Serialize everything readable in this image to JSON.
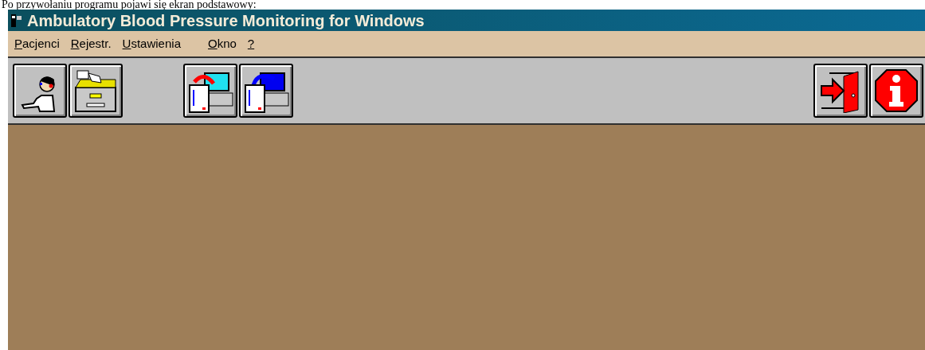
{
  "caption": "Po przywołaniu programu pojawi się ekran podstawowy:",
  "window": {
    "title": "Ambulatory Blood Pressure Monitoring for Windows"
  },
  "menu": [
    {
      "label": "Pacjenci"
    },
    {
      "label": "Rejestr."
    },
    {
      "label": "Ustawienia"
    },
    {
      "label": "Okno"
    },
    {
      "label": "?"
    }
  ],
  "toolbar": {
    "left": [
      {
        "kind": "patient"
      },
      {
        "kind": "archive"
      }
    ],
    "middle": [
      {
        "kind": "download"
      },
      {
        "kind": "upload"
      }
    ],
    "right": [
      {
        "kind": "exit"
      },
      {
        "kind": "info"
      }
    ]
  }
}
